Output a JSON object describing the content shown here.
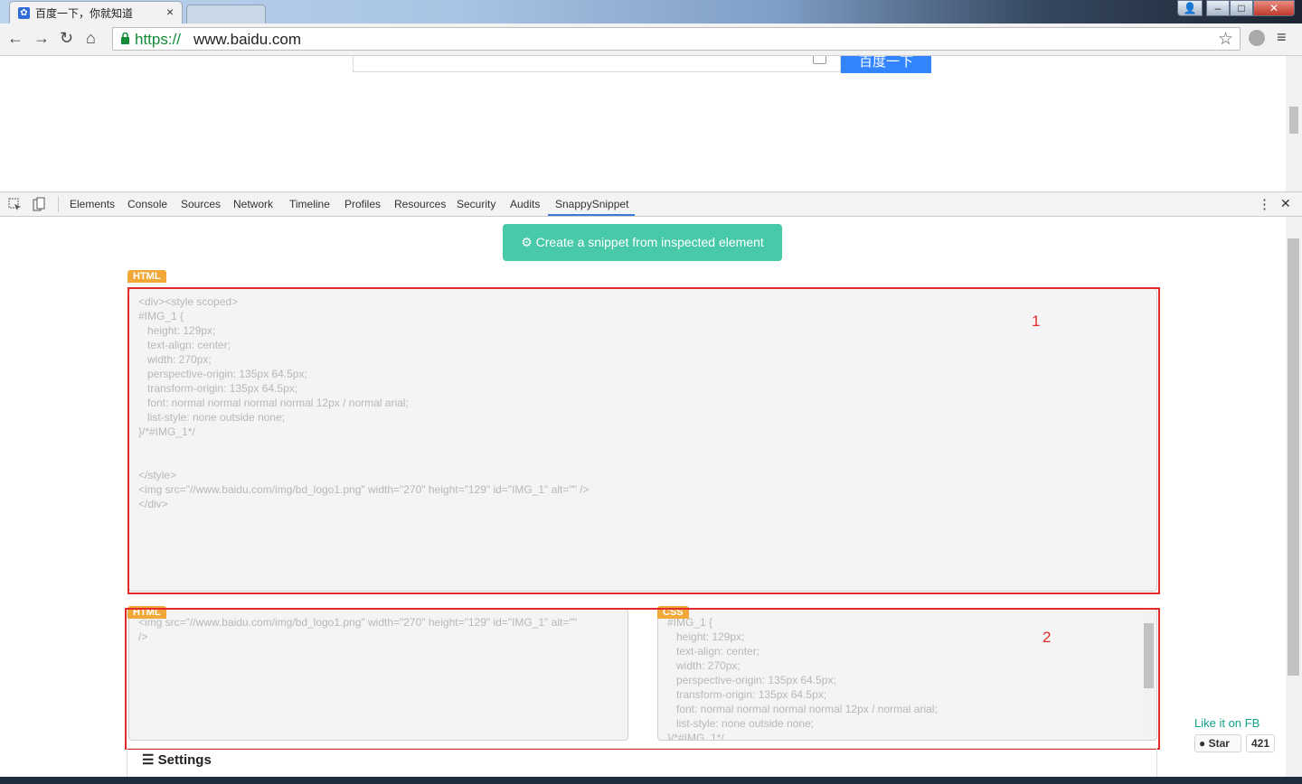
{
  "browser": {
    "tab_title": "百度一下，你就知道",
    "tab_close": "×",
    "url_scheme": "https://",
    "url_rest": "www.baidu.com",
    "nav": {
      "back": "←",
      "forward": "→",
      "reload": "↻",
      "home": "⌂"
    },
    "star": "☆",
    "menu": "≡",
    "window_buttons": {
      "user": "👤",
      "minimize": "–",
      "maximize": "□",
      "close": "✕"
    }
  },
  "page": {
    "search_button_label": "百度一下"
  },
  "devtools": {
    "tabs": [
      "Elements",
      "Console",
      "Sources",
      "Network",
      "Timeline",
      "Profiles",
      "Resources",
      "Security",
      "Audits",
      "SnappySnippet"
    ],
    "active_tab": "SnappySnippet",
    "more": "⋮",
    "close": "✕"
  },
  "snappy": {
    "create_button": "Create a snippet from inspected element",
    "html_badge": "HTML",
    "css_badge": "CSS",
    "combined_code": "<div><style scoped>\n#IMG_1 {\n   height: 129px;\n   text-align: center;\n   width: 270px;\n   perspective-origin: 135px 64.5px;\n   transform-origin: 135px 64.5px;\n   font: normal normal normal normal 12px / normal arial;\n   list-style: none outside none;\n}/*#IMG_1*/\n\n\n</style>\n<img src=\"//www.baidu.com/img/bd_logo1.png\" width=\"270\" height=\"129\" id=\"IMG_1\" alt=\"\" />\n</div>",
    "html_code": "<img src=\"//www.baidu.com/img/bd_logo1.png\" width=\"270\" height=\"129\" id=\"IMG_1\" alt=\"\"\n/>",
    "css_code": "#IMG_1 {\n   height: 129px;\n   text-align: center;\n   width: 270px;\n   perspective-origin: 135px 64.5px;\n   transform-origin: 135px 64.5px;\n   font: normal normal normal normal 12px / normal arial;\n   list-style: none outside none;\n}/*#IMG_1*/",
    "annotation_1": "1",
    "annotation_2": "2",
    "settings_label": "Settings",
    "fb_label": "Like it on FB",
    "star_label": "Star",
    "star_count": "421"
  }
}
